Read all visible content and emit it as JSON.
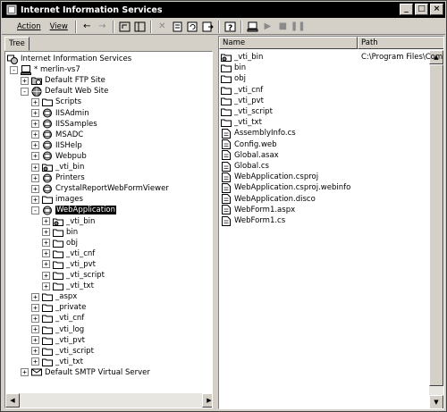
{
  "window": {
    "title": "Internet Information Services"
  },
  "menu": {
    "action": "Action",
    "view": "View"
  },
  "left": {
    "tab": "Tree",
    "items": [
      {
        "label": "Internet Information Services",
        "depth": 0,
        "expander": "",
        "icon": "iis-icon"
      },
      {
        "label": "* merlin-vs7",
        "depth": 1,
        "expander": "−",
        "icon": "computer-icon"
      },
      {
        "label": "Default FTP Site",
        "depth": 2,
        "expander": "+",
        "icon": "ftp-site-icon"
      },
      {
        "label": "Default Web Site",
        "depth": 2,
        "expander": "−",
        "icon": "web-site-icon"
      },
      {
        "label": "Scripts",
        "depth": 3,
        "expander": "+",
        "icon": "folder-icon"
      },
      {
        "label": "IISAdmin",
        "depth": 3,
        "expander": "+",
        "icon": "web-app-icon"
      },
      {
        "label": "IISSamples",
        "depth": 3,
        "expander": "+",
        "icon": "web-app-icon"
      },
      {
        "label": "MSADC",
        "depth": 3,
        "expander": "+",
        "icon": "web-app-icon"
      },
      {
        "label": "IISHelp",
        "depth": 3,
        "expander": "+",
        "icon": "web-app-icon"
      },
      {
        "label": "Webpub",
        "depth": 3,
        "expander": "+",
        "icon": "web-app-icon"
      },
      {
        "label": "_vti_bin",
        "depth": 3,
        "expander": "+",
        "icon": "virtual-dir-icon"
      },
      {
        "label": "Printers",
        "depth": 3,
        "expander": "+",
        "icon": "web-app-icon"
      },
      {
        "label": "CrystalReportWebFormViewer",
        "depth": 3,
        "expander": "+",
        "icon": "web-app-icon"
      },
      {
        "label": "images",
        "depth": 3,
        "expander": "+",
        "icon": "folder-icon"
      },
      {
        "label": "WebApplication",
        "depth": 3,
        "expander": "−",
        "icon": "web-app-icon",
        "selected": true
      },
      {
        "label": "_vti_bin",
        "depth": 4,
        "expander": "+",
        "icon": "virtual-dir-icon"
      },
      {
        "label": "bin",
        "depth": 4,
        "expander": "+",
        "icon": "folder-icon"
      },
      {
        "label": "obj",
        "depth": 4,
        "expander": "+",
        "icon": "folder-icon"
      },
      {
        "label": "_vti_cnf",
        "depth": 4,
        "expander": "+",
        "icon": "folder-icon"
      },
      {
        "label": "_vti_pvt",
        "depth": 4,
        "expander": "+",
        "icon": "folder-icon"
      },
      {
        "label": "_vti_script",
        "depth": 4,
        "expander": "+",
        "icon": "folder-icon"
      },
      {
        "label": "_vti_txt",
        "depth": 4,
        "expander": "+",
        "icon": "folder-icon"
      },
      {
        "label": "_aspx",
        "depth": 3,
        "expander": "+",
        "icon": "folder-icon"
      },
      {
        "label": "_private",
        "depth": 3,
        "expander": "+",
        "icon": "folder-icon"
      },
      {
        "label": "_vti_cnf",
        "depth": 3,
        "expander": "+",
        "icon": "folder-icon"
      },
      {
        "label": "_vti_log",
        "depth": 3,
        "expander": "+",
        "icon": "folder-icon"
      },
      {
        "label": "_vti_pvt",
        "depth": 3,
        "expander": "+",
        "icon": "folder-icon"
      },
      {
        "label": "_vti_script",
        "depth": 3,
        "expander": "+",
        "icon": "folder-icon"
      },
      {
        "label": "_vti_txt",
        "depth": 3,
        "expander": "+",
        "icon": "folder-icon"
      },
      {
        "label": "Default SMTP Virtual Server",
        "depth": 2,
        "expander": "+",
        "icon": "smtp-icon"
      }
    ]
  },
  "right": {
    "columns": {
      "name": "Name",
      "path": "Path"
    },
    "items": [
      {
        "label": "_vti_bin",
        "icon": "virtual-dir-icon",
        "path": "C:\\Program Files\\Common"
      },
      {
        "label": "bin",
        "icon": "folder-icon",
        "path": ""
      },
      {
        "label": "obj",
        "icon": "folder-icon",
        "path": ""
      },
      {
        "label": "_vti_cnf",
        "icon": "folder-icon",
        "path": ""
      },
      {
        "label": "_vti_pvt",
        "icon": "folder-icon",
        "path": ""
      },
      {
        "label": "_vti_script",
        "icon": "folder-icon",
        "path": ""
      },
      {
        "label": "_vti_txt",
        "icon": "folder-icon",
        "path": ""
      },
      {
        "label": "AssemblyInfo.cs",
        "icon": "file-icon",
        "path": ""
      },
      {
        "label": "Config.web",
        "icon": "file-icon",
        "path": ""
      },
      {
        "label": "Global.asax",
        "icon": "file-icon",
        "path": ""
      },
      {
        "label": "Global.cs",
        "icon": "file-icon",
        "path": ""
      },
      {
        "label": "WebApplication.csproj",
        "icon": "file-icon",
        "path": ""
      },
      {
        "label": "WebApplication.csproj.webinfo",
        "icon": "file-icon",
        "path": ""
      },
      {
        "label": "WebApplication.disco",
        "icon": "file-icon",
        "path": ""
      },
      {
        "label": "WebForm1.aspx",
        "icon": "file-icon",
        "path": ""
      },
      {
        "label": "WebForm1.cs",
        "icon": "file-icon",
        "path": ""
      }
    ]
  }
}
